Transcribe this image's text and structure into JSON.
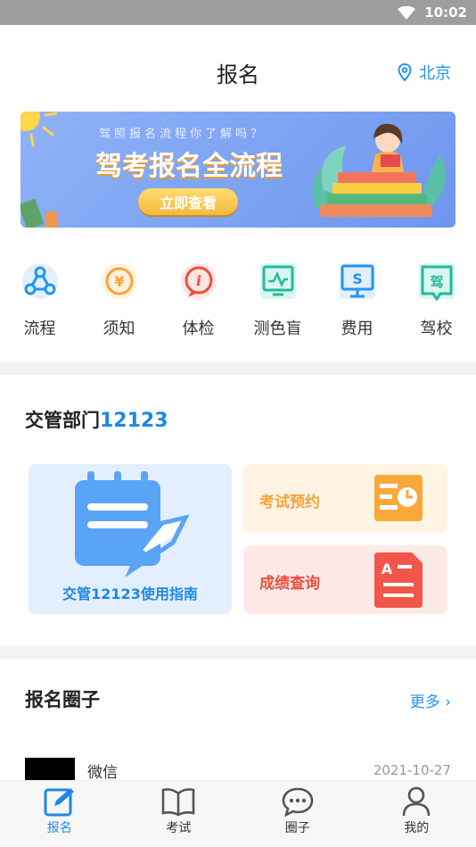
{
  "status_bar": {
    "time": "10:02"
  },
  "header": {
    "title": "报名",
    "city": "北京"
  },
  "banner": {
    "subtitle": "驾照报名流程你了解吗？",
    "title": "驾考报名全流程",
    "button": "立即查看"
  },
  "quick_items": [
    {
      "label": "流程",
      "icon": "process-icon"
    },
    {
      "label": "须知",
      "icon": "notice-icon"
    },
    {
      "label": "体检",
      "icon": "checkup-icon"
    },
    {
      "label": "测色盲",
      "icon": "colorblind-test-icon"
    },
    {
      "label": "费用",
      "icon": "fee-icon"
    },
    {
      "label": "驾校",
      "icon": "driving-school-icon"
    }
  ],
  "traffic": {
    "title_prefix": "交管部门",
    "title_number": "12123",
    "guide": "交管12123使用指南",
    "exam_booking": "考试预约",
    "score_query": "成绩查询",
    "guide_icon_badge": "A"
  },
  "circle": {
    "title": "报名圈子",
    "more": "更多",
    "posts": [
      {
        "name": "微信",
        "date": "2021-10-27"
      }
    ]
  },
  "tabbar": [
    {
      "label": "报名",
      "active": true
    },
    {
      "label": "考试",
      "active": false
    },
    {
      "label": "圈子",
      "active": false
    },
    {
      "label": "我的",
      "active": false
    }
  ],
  "colors": {
    "accent": "#1e88e5",
    "orange": "#f6a33a",
    "red": "#ee4d3d",
    "banner": "#7ea4f2"
  }
}
